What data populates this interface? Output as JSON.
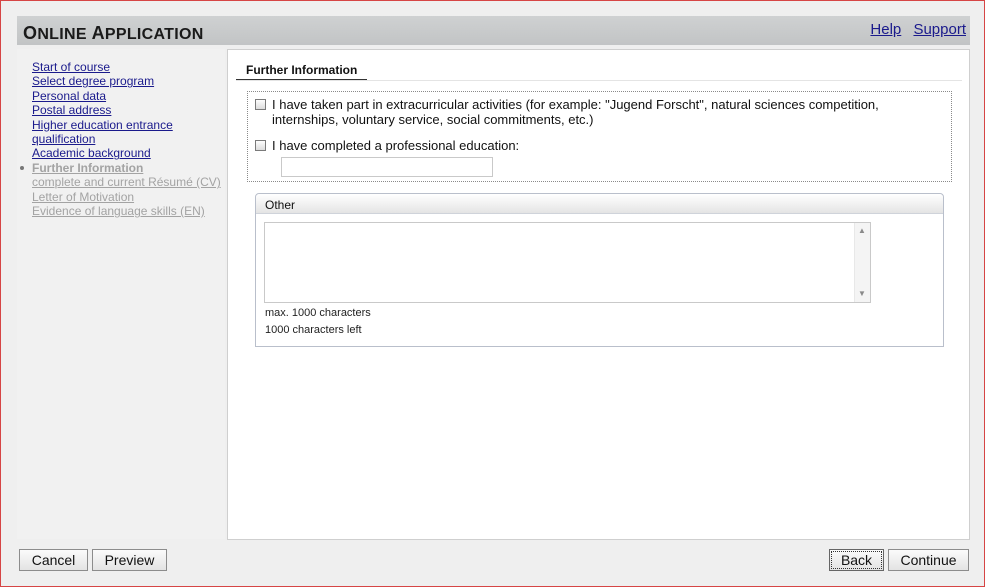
{
  "header": {
    "title_first": "O",
    "title_rest": "NLINE ",
    "title_second_first": "A",
    "title_second_rest": "PPLICATION",
    "links": [
      {
        "label": "Help"
      },
      {
        "label": "Support"
      }
    ]
  },
  "sidebar": {
    "items": [
      {
        "label": "Start of course",
        "state": "done"
      },
      {
        "label": "Select degree program",
        "state": "done"
      },
      {
        "label": "Personal data",
        "state": "done"
      },
      {
        "label": "Postal address",
        "state": "done"
      },
      {
        "label": "Higher education entrance qualification",
        "state": "done"
      },
      {
        "label": "Academic background",
        "state": "done"
      },
      {
        "label": "Further Information",
        "state": "current"
      },
      {
        "label": "complete and current Résumé (CV)",
        "state": "todo"
      },
      {
        "label": "Letter of Motivation",
        "state": "todo"
      },
      {
        "label": "Evidence of language skills (EN)",
        "state": "todo"
      }
    ]
  },
  "main": {
    "tab_title": "Further Information",
    "checkbox_extracurricular": {
      "label": "I have taken part in extracurricular activities (for example: \"Jugend Forscht\", natural sciences competition, internships, voluntary service, social commitments, etc.)",
      "checked": false
    },
    "checkbox_professional": {
      "label": "I have completed a professional education:",
      "checked": false
    },
    "professional_input": {
      "value": "",
      "placeholder": ""
    },
    "other_panel": {
      "title": "Other",
      "textarea_value": "",
      "max_hint": "max. 1000 characters",
      "left_hint": "1000 characters left"
    }
  },
  "footer": {
    "cancel_label": "Cancel",
    "preview_label": "Preview",
    "back_label": "Back",
    "continue_label": "Continue"
  },
  "colors": {
    "link": "#1a1a8c",
    "header_bg": "#c8cacb",
    "window_border": "#d64545",
    "disabled_text": "#a3a3a3"
  }
}
